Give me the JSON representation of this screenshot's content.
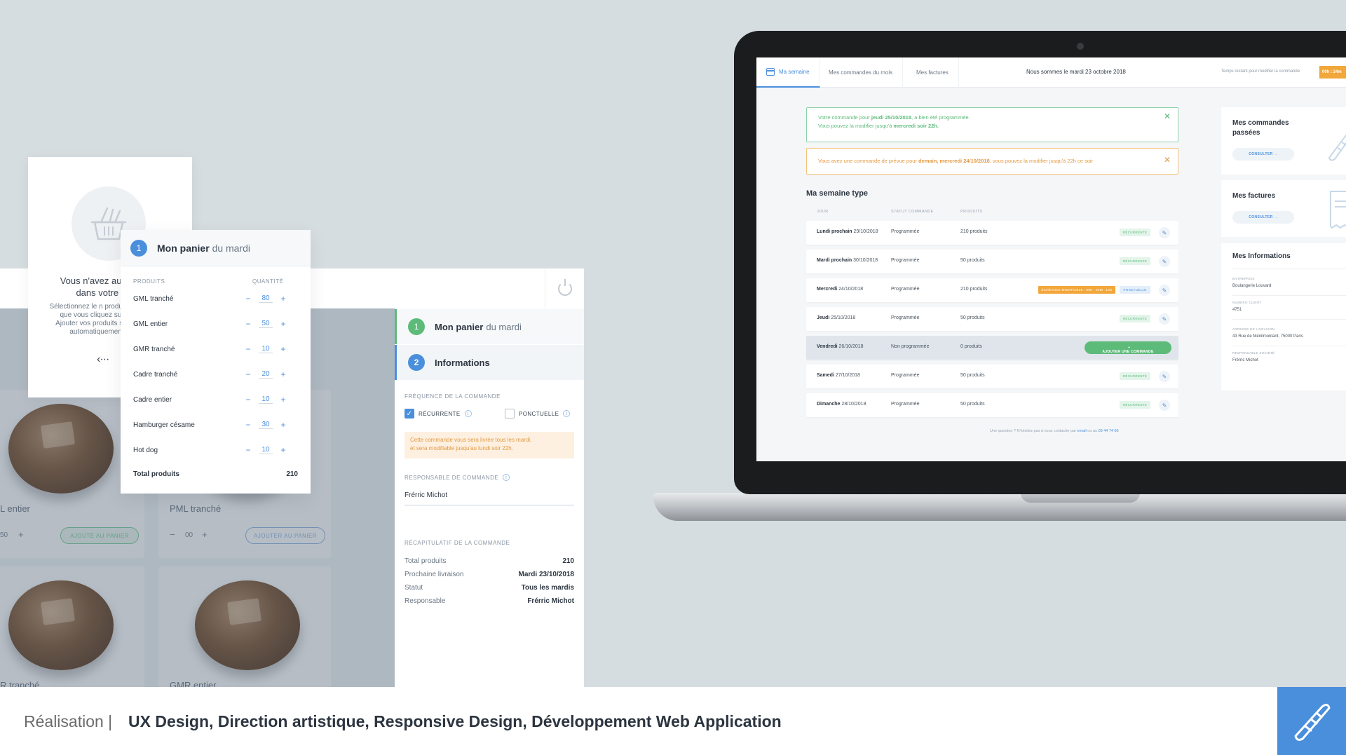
{
  "basket_panel": {
    "step": "1",
    "title_main": "Mon panier",
    "title_sub": "du mardi",
    "col_products": "PRODUITS",
    "col_quantity": "QUANTITÉ",
    "items": [
      {
        "name": "GML tranché",
        "qty": "80"
      },
      {
        "name": "GML entier",
        "qty": "50"
      },
      {
        "name": "GMR tranché",
        "qty": "10"
      },
      {
        "name": "Cadre tranché",
        "qty": "20"
      },
      {
        "name": "Cadre entier",
        "qty": "10"
      },
      {
        "name": "Hamburger césame",
        "qty": "30"
      },
      {
        "name": "Hot dog",
        "qty": "10"
      }
    ],
    "total_label": "Total produits",
    "total_value": "210"
  },
  "empty_basket": {
    "title": "Vous n'avez auc dans votre p",
    "text": "Sélectionnez le n produits que vous cliquez sur « Ajouter vos produits s'aj automatiquement à"
  },
  "catalog": {
    "products": [
      {
        "name": "L entier",
        "qty": "50",
        "button": "AJOUTÉ AU PANIER"
      },
      {
        "name": "PML tranché",
        "qty": "00",
        "button": "AJOUTER AU PANIER"
      },
      {
        "name": "R tranché"
      },
      {
        "name": "GMR entier"
      }
    ]
  },
  "order_panel": {
    "step1_num": "1",
    "step1_main": "Mon panier",
    "step1_sub": "du mardi",
    "step2_num": "2",
    "step2_label": "Informations",
    "freq_label": "FRÉQUENCE DE LA COMMANDE",
    "opt_recurring": "RÉCURRENTE",
    "opt_punctual": "PONCTUELLE",
    "warning_line1": "Cette commande vous sera livrée tous les mardi,",
    "warning_line2": "et sera modifiable jusqu'au lundi soir 22h.",
    "resp_label": "RESPONSABLE DE COMMANDE",
    "resp_value": "Frérric Michot",
    "recap_label": "RÉCAPITULATIF DE LA COMMANDE",
    "recap": [
      {
        "label": "Total produits",
        "value": "210"
      },
      {
        "label": "Prochaine livraison",
        "value": "Mardi 23/10/2018"
      },
      {
        "label": "Statut",
        "value": "Tous les mardis"
      },
      {
        "label": "Responsable",
        "value": "Frérric Michot"
      }
    ]
  },
  "app": {
    "tabs": [
      "Ma semaine",
      "Mes commandes du mois",
      "Mes factures"
    ],
    "date_text": "Nous sommes le mardi 23 octobre 2018",
    "time_label": "Temps restant pour modifier la commande",
    "time_badge": "00h : 24m",
    "alert_ok_1a": "Votre commande pour ",
    "alert_ok_1b": "jeudi 25/10/2018",
    "alert_ok_1c": ", a bien été programmée.",
    "alert_ok_2a": "Vous pouvez la modifier jusqu'à ",
    "alert_ok_2b": "mercredi soir 22h.",
    "alert_warn_a": "Vous avez une commande de prévue pour ",
    "alert_warn_b": "demain, mercredi 24/10/2018",
    "alert_warn_c": ", vous pouvez la modifier jusqu'à 22h ce soir",
    "section_title": "Ma semaine type",
    "col_day": "JOUR",
    "col_status": "STATUT COMMANDE",
    "col_products": "PRODUITS",
    "rows": [
      {
        "day": "Lundi prochain",
        "date": "29/10/2018",
        "status": "Programmée",
        "products": "210 produits",
        "badge": "RÉCURRENTE"
      },
      {
        "day": "Mardi prochain",
        "date": "30/10/2018",
        "status": "Programmée",
        "products": "50 produits",
        "badge": "RÉCURRENTE"
      },
      {
        "day": "Mercredi",
        "date": "24/10/2018",
        "status": "Programmée",
        "products": "210 produits",
        "badge": "PONCTUELLE",
        "extra": "ÉCHÉANCE MODIFIABLE : 00H : 24M : 10S"
      },
      {
        "day": "Jeudi",
        "date": "25/10/2018",
        "status": "Programmée",
        "products": "50 produits",
        "badge": "RÉCURRENTE"
      },
      {
        "day": "Vendredi",
        "date": "26/10/2018",
        "status": "Non programmée",
        "products": "0 produits",
        "button": "AJOUTER UNE COMMANDE"
      },
      {
        "day": "Samedi",
        "date": "27/10/2018",
        "status": "Programmée",
        "products": "50 produits",
        "badge": "RÉCURRENTE"
      },
      {
        "day": "Dimanche",
        "date": "28/10/2018",
        "status": "Programmée",
        "products": "50 produits",
        "badge": "RÉCURRENTE"
      }
    ],
    "footer_text": "Une question ? N'hésitez pas à nous contacter par ",
    "footer_email": "email",
    "footer_or": " ou au ",
    "footer_phone": "03 44 74 66",
    "side": {
      "orders_title": "Mes commandes passées",
      "orders_btn": "CONSULTER →",
      "invoices_title": "Mes factures",
      "invoices_btn": "CONSULTER →",
      "info_title": "Mes Informations",
      "info": [
        {
          "label": "ENTREPRISE",
          "value": "Boulangerie Louvard"
        },
        {
          "label": "NUMÉRO CLIENT",
          "value": "4751"
        },
        {
          "label": "ADRESSE DE LIVRAISON",
          "value": "43 Rue de Ménilmontant, 75000 Paris"
        },
        {
          "label": "RESPONSABLE SOCIÉTÉ",
          "value": "Frérric Michot"
        }
      ]
    }
  },
  "footer": {
    "label": "Réalisation |",
    "skills": "UX Design, Direction artistique, Responsive Design, Développement Web Application"
  },
  "colors": {
    "accent_blue": "#4a8fdc",
    "success_green": "#5dbb7a",
    "warning_orange": "#f2a73b",
    "background": "#d6dde0"
  }
}
